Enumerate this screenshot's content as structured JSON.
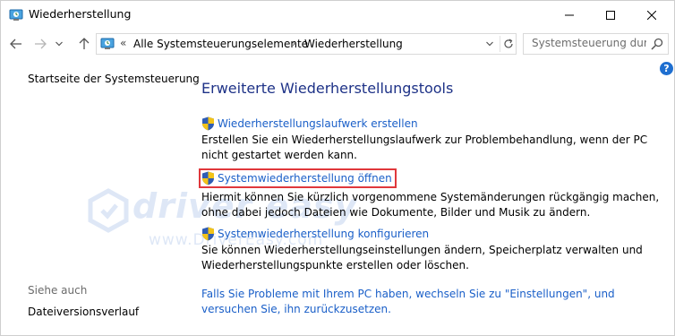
{
  "window": {
    "title": "Wiederherstellung",
    "colors": {
      "link": "#1a5fc8",
      "heading": "#1e3287",
      "highlight_border": "#e0383c",
      "help": "#1f6fd0"
    }
  },
  "nav": {
    "back_icon": "arrow-left-icon",
    "forward_icon": "arrow-right-icon",
    "recent_icon": "chevron-down-icon",
    "up_icon": "arrow-up-icon",
    "address": {
      "overflow": "«",
      "crumbs": [
        "Alle Systemsteuerungselemente",
        "Wiederherstellung"
      ],
      "separator": "›"
    },
    "search_placeholder": "Systemsteuerung dur..."
  },
  "help": {
    "label": "?"
  },
  "left_pane": {
    "home_link": "Startseite der Systemsteuerung",
    "see_also_heading": "Siehe auch",
    "see_also_links": [
      "Dateiversionsverlauf"
    ]
  },
  "main": {
    "title": "Erweiterte Wiederherstellungstools",
    "tasks": [
      {
        "link": "Wiederherstellungslaufwerk erstellen",
        "description": "Erstellen Sie ein Wiederherstellungslaufwerk zur Problembehandlung, wenn der PC nicht gestartet werden kann."
      },
      {
        "link": "Systemwiederherstellung öffnen",
        "description": "Hiermit können Sie kürzlich vorgenommene Systemänderungen rückgängig machen, ohne dabei jedoch Dateien wie Dokumente, Bilder und Musik zu ändern.",
        "highlighted": true
      },
      {
        "link": "Systemwiederherstellung konfigurieren",
        "description": "Sie können Wiederherstellungseinstellungen ändern, Speicherplatz verwalten und Wiederherstellungspunkte erstellen oder löschen."
      }
    ],
    "bottom_link": "Falls Sie Probleme mit Ihrem PC haben, wechseln Sie zu \"Einstellungen\", und versuchen Sie, ihn zurückzusetzen."
  },
  "watermark": {
    "text": "driver easy",
    "sub": "www.DriverEasy.com"
  }
}
